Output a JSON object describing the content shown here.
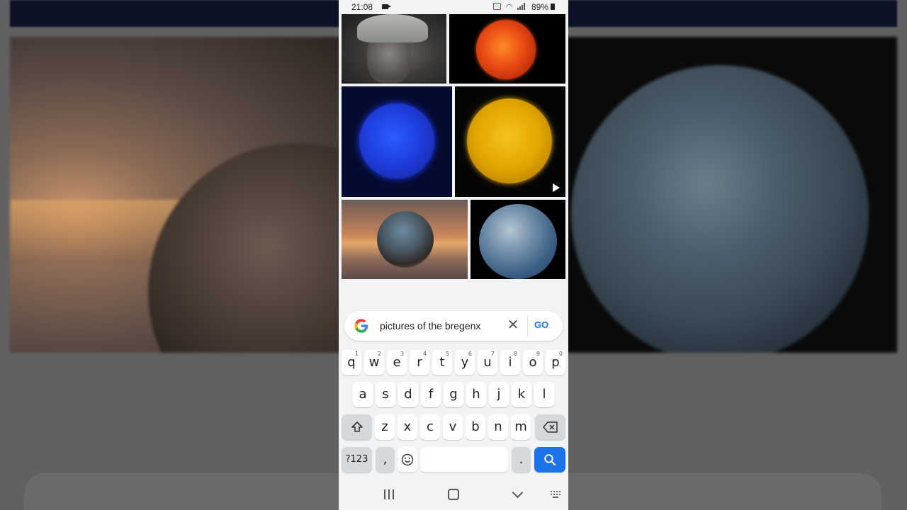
{
  "status_bar": {
    "time": "21:08",
    "battery": "89%"
  },
  "image_results": [
    {
      "name": "man-portrait"
    },
    {
      "name": "red-sun"
    },
    {
      "name": "blue-sun"
    },
    {
      "name": "yellow-sun",
      "has_video": true
    },
    {
      "name": "crystal-ball-tree"
    },
    {
      "name": "earth"
    }
  ],
  "search": {
    "query": "pictures of the bregenx",
    "go_label": "GO"
  },
  "keyboard": {
    "row1": [
      {
        "key": "q",
        "hint": "1"
      },
      {
        "key": "w",
        "hint": "2"
      },
      {
        "key": "e",
        "hint": "3"
      },
      {
        "key": "r",
        "hint": "4"
      },
      {
        "key": "t",
        "hint": "5"
      },
      {
        "key": "y",
        "hint": "6"
      },
      {
        "key": "u",
        "hint": "7"
      },
      {
        "key": "i",
        "hint": "8"
      },
      {
        "key": "o",
        "hint": "9"
      },
      {
        "key": "p",
        "hint": "0"
      }
    ],
    "row2": [
      "a",
      "s",
      "d",
      "f",
      "g",
      "h",
      "j",
      "k",
      "l"
    ],
    "row3": [
      "z",
      "x",
      "c",
      "v",
      "b",
      "n",
      "m"
    ],
    "symbols_label": "?123",
    "comma_label": ",",
    "period_label": "."
  },
  "colors": {
    "accent": "#1a73e8",
    "background": "#f2f3f5"
  }
}
